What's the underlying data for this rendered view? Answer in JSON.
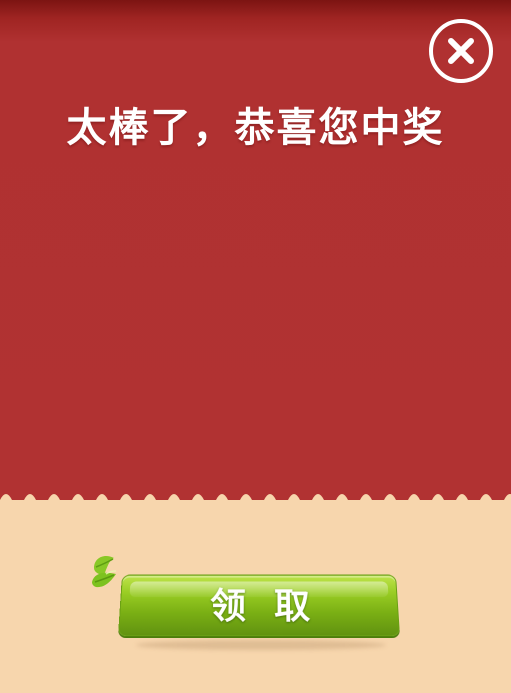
{
  "modal": {
    "title": "太棒了，恭喜您中奖",
    "claim_button_label": "领取",
    "close_icon": "close-icon",
    "leaf_icon": "leaf-icon"
  },
  "colors": {
    "top_panel": "#b13232",
    "top_panel_dark": "#7c1412",
    "bottom_panel": "#f7d6ad",
    "button_green": "#7aaf14",
    "button_green_light": "#bfe34a",
    "leaf_green": "#7dc21f",
    "title_text": "#ffffff"
  }
}
